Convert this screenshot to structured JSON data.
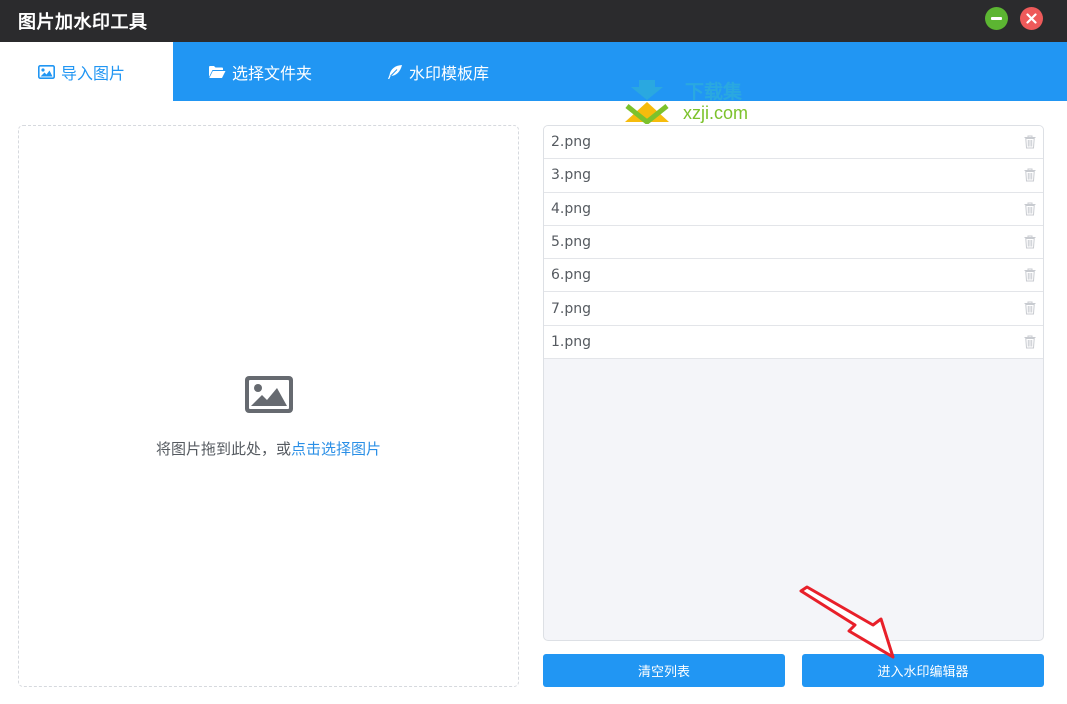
{
  "window": {
    "title": "图片加水印工具"
  },
  "tabs": [
    {
      "label": "导入图片",
      "icon": "image-icon",
      "active": true
    },
    {
      "label": "选择文件夹",
      "icon": "folder-open-icon",
      "active": false
    },
    {
      "label": "水印模板库",
      "icon": "feather-icon",
      "active": false
    }
  ],
  "dropzone": {
    "text": "将图片拖到此处，或",
    "link": "点击选择图片",
    "icon": "image-icon"
  },
  "files": [
    {
      "name": "2.png"
    },
    {
      "name": "3.png"
    },
    {
      "name": "4.png"
    },
    {
      "name": "5.png"
    },
    {
      "name": "6.png"
    },
    {
      "name": "7.png"
    },
    {
      "name": "1.png"
    }
  ],
  "buttons": {
    "clear": "清空列表",
    "editor": "进入水印编辑器"
  },
  "watermark": {
    "line1": "下载集",
    "line2": "xzji.com"
  },
  "colors": {
    "accent": "#2196f3",
    "titlebar": "#2b2b2d",
    "minimize": "#5cb532",
    "close": "#ee5a5a",
    "annotation": "#e8202a"
  }
}
